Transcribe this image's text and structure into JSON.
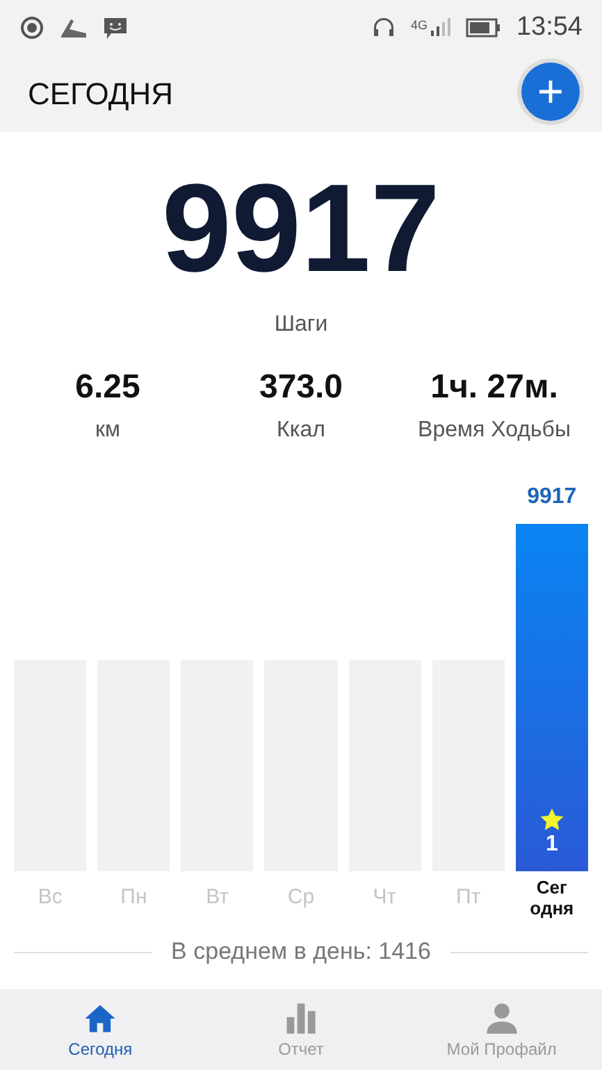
{
  "status_bar": {
    "network": "4G",
    "time": "13:54"
  },
  "header": {
    "title": "СЕГОДНЯ"
  },
  "steps": {
    "value": "9917",
    "label": "Шаги"
  },
  "stats": [
    {
      "value": "6.25",
      "label": "км"
    },
    {
      "value": "373.0",
      "label": "Ккал"
    },
    {
      "value": "1ч. 27м.",
      "label": "Время Ходьбы"
    }
  ],
  "week": [
    {
      "label": "Вс",
      "selected": false
    },
    {
      "label": "Пн",
      "selected": false
    },
    {
      "label": "Вт",
      "selected": false
    },
    {
      "label": "Ср",
      "selected": false
    },
    {
      "label": "Чт",
      "selected": false
    },
    {
      "label": "Пт",
      "selected": false
    },
    {
      "label": "Сег\nодня",
      "selected": true,
      "value": "9917",
      "badge": "1"
    }
  ],
  "average": "В среднем в день: 1416",
  "nav": [
    {
      "label": "Сегодня",
      "selected": true
    },
    {
      "label": "Отчет",
      "selected": false
    },
    {
      "label": "Мой Профайл",
      "selected": false
    }
  ]
}
